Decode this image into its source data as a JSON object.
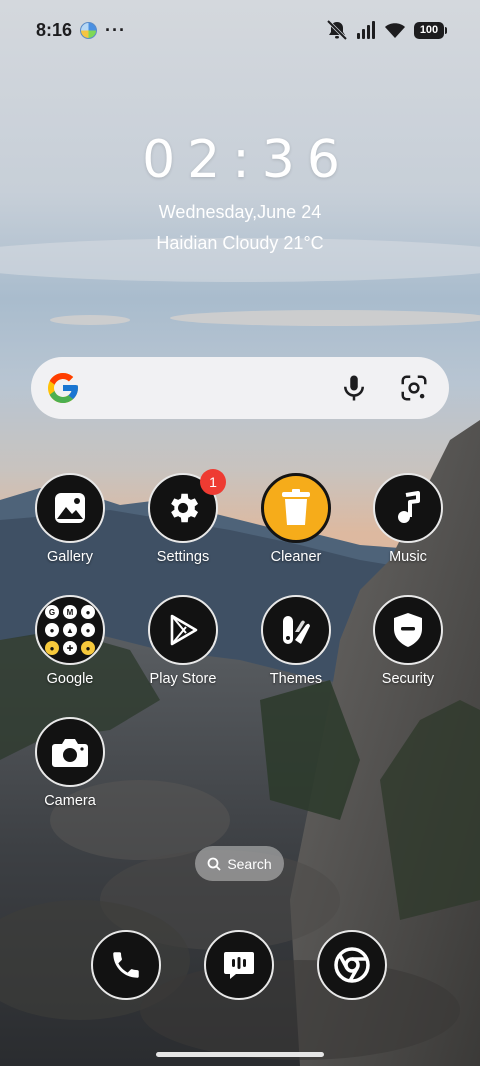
{
  "status_bar": {
    "time": "8:16",
    "more": "···",
    "battery": "100"
  },
  "clock": {
    "time": "02:36",
    "date": "Wednesday,June 24",
    "weather": "Haidian Cloudy 21°C"
  },
  "search_widget": {
    "logo": "google-g-icon",
    "mic": "microphone-icon",
    "lens": "google-lens-icon"
  },
  "apps": [
    {
      "label": "Gallery",
      "icon": "gallery-icon"
    },
    {
      "label": "Settings",
      "icon": "gear-icon",
      "badge": "1"
    },
    {
      "label": "Cleaner",
      "icon": "trash-can-icon"
    },
    {
      "label": "Music",
      "icon": "music-note-icon"
    },
    {
      "label": "Google",
      "icon": "google-folder-icon"
    },
    {
      "label": "Play Store",
      "icon": "play-store-icon"
    },
    {
      "label": "Themes",
      "icon": "themes-icon"
    },
    {
      "label": "Security",
      "icon": "shield-icon"
    },
    {
      "label": "Camera",
      "icon": "camera-icon"
    }
  ],
  "folder_items": [
    "G",
    "M",
    "●",
    "●",
    "▲",
    "●",
    "●",
    "✚",
    "●"
  ],
  "search_pill": {
    "label": "Search"
  },
  "dock": [
    {
      "icon": "phone-icon"
    },
    {
      "icon": "messages-icon"
    },
    {
      "icon": "chrome-icon"
    }
  ],
  "colors": {
    "badge": "#ee3b32",
    "cleaner": "#f6ac1a",
    "icon_bg": "#121212"
  }
}
